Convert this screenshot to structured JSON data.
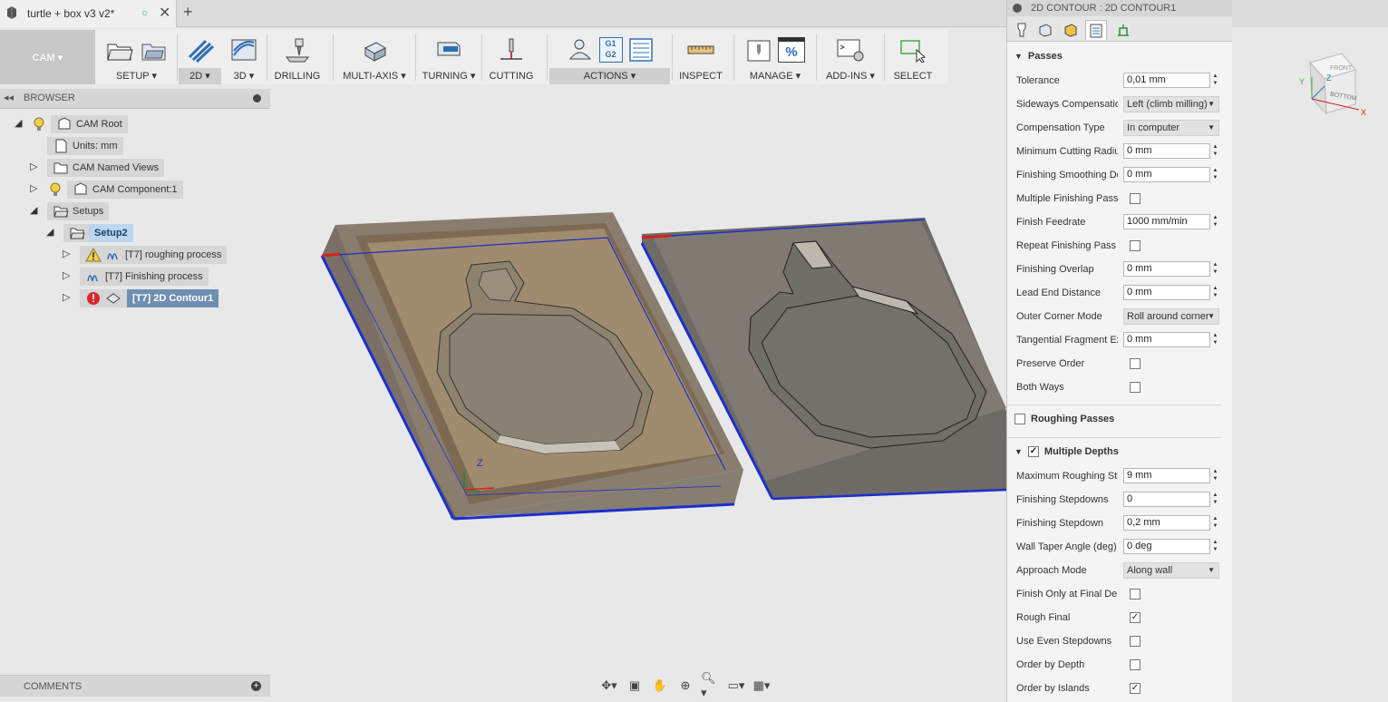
{
  "titlebar": {
    "doc_title": "turtle + box v3 v2*",
    "new_tab": "+"
  },
  "toolbar": {
    "workspace": "CAM ▾",
    "groups": [
      {
        "label": "SETUP ▾"
      },
      {
        "label": "2D ▾"
      },
      {
        "label": "3D ▾"
      },
      {
        "label": "DRILLING"
      },
      {
        "label": "MULTI-AXIS ▾"
      },
      {
        "label": "TURNING ▾"
      },
      {
        "label": "CUTTING"
      },
      {
        "label": "ACTIONS ▾"
      },
      {
        "label": "INSPECT"
      },
      {
        "label": "MANAGE ▾"
      },
      {
        "label": "ADD-INS ▾"
      },
      {
        "label": "SELECT"
      }
    ],
    "actions_g1": "G1",
    "actions_g2": "G2",
    "manage_percent": "%"
  },
  "browser": {
    "title": "BROWSER",
    "items": [
      {
        "label": "CAM Root"
      },
      {
        "label": "Units: mm"
      },
      {
        "label": "CAM Named Views"
      },
      {
        "label": "CAM Component:1"
      },
      {
        "label": "Setups"
      },
      {
        "label": "Setup2"
      },
      {
        "label": "[T7] roughing process"
      },
      {
        "label": "[T7] Finishing process"
      },
      {
        "label": "[T7] 2D Contour1"
      }
    ]
  },
  "comments": {
    "title": "COMMENTS"
  },
  "viewcube": {
    "front": "FRONT",
    "bottom": "BOTTOM",
    "axis_x": "X",
    "axis_y": "Y",
    "axis_z": "Z"
  },
  "viewport": {
    "axis_z": "Z"
  },
  "panel": {
    "title": "2D CONTOUR : 2D CONTOUR1",
    "passes_header": "Passes",
    "rows": [
      {
        "label": "Tolerance",
        "value": "0,01 mm"
      },
      {
        "label": "Sideways Compensation",
        "value": "Left (climb milling)"
      },
      {
        "label": "Compensation Type",
        "value": "In computer"
      },
      {
        "label": "Minimum Cutting Radius",
        "value": "0 mm"
      },
      {
        "label": "Finishing Smoothing Deviation",
        "value": "0 mm"
      },
      {
        "label": "Multiple Finishing Passes",
        "checked": false
      },
      {
        "label": "Finish Feedrate",
        "value": "1000 mm/min"
      },
      {
        "label": "Repeat Finishing Pass",
        "checked": false
      },
      {
        "label": "Finishing Overlap",
        "value": "0 mm"
      },
      {
        "label": "Lead End Distance",
        "value": "0 mm"
      },
      {
        "label": "Outer Corner Mode",
        "value": "Roll around corner"
      },
      {
        "label": "Tangential Fragment Extension Distance",
        "value": "0 mm"
      },
      {
        "label": "Preserve Order",
        "checked": false
      },
      {
        "label": "Both Ways",
        "checked": false
      }
    ],
    "roughing_passes": "Roughing Passes",
    "multiple_depths": "Multiple Depths",
    "depth_rows": [
      {
        "label": "Maximum Roughing Stepdown",
        "value": "9 mm"
      },
      {
        "label": "Finishing Stepdowns",
        "value": "0"
      },
      {
        "label": "Finishing Stepdown",
        "value": "0,2 mm"
      },
      {
        "label": "Wall Taper Angle (deg)",
        "value": "0 deg"
      },
      {
        "label": "Approach Mode",
        "value": "Along wall"
      },
      {
        "label": "Finish Only at Final Depth",
        "checked": false
      },
      {
        "label": "Rough Final",
        "checked": true
      },
      {
        "label": "Use Even Stepdowns",
        "checked": false
      },
      {
        "label": "Order by Depth",
        "checked": false
      },
      {
        "label": "Order by Islands",
        "checked": true
      }
    ]
  }
}
